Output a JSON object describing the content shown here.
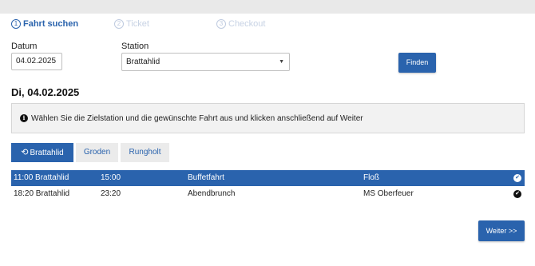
{
  "steps": [
    {
      "number": "1",
      "label": "Fahrt suchen"
    },
    {
      "number": "2",
      "label": "Ticket"
    },
    {
      "number": "3",
      "label": "Checkout"
    }
  ],
  "form": {
    "date_label": "Datum",
    "date_value": "04.02.2025",
    "station_label": "Station",
    "station_value": "Brattahlid",
    "find_button": "Finden"
  },
  "date_heading": "Di, 04.02.2025",
  "info_message": "Wählen Sie die Zielstation und die gewünschte Fahrt aus und klicken anschließend auf Weiter",
  "tabs": [
    {
      "label": "Brattahlid",
      "active": true
    },
    {
      "label": "Groden",
      "active": false
    },
    {
      "label": "Rungholt",
      "active": false
    }
  ],
  "trips": [
    {
      "departure": "11:00 Brattahlid",
      "arrival": "15:00",
      "name": "Buffetfahrt",
      "vessel": "Floß",
      "selected": true
    },
    {
      "departure": "18:20 Brattahlid",
      "arrival": "23:20",
      "name": "Abendbrunch",
      "vessel": "MS Oberfeuer",
      "selected": false
    }
  ],
  "next_button": "Weiter >>",
  "colors": {
    "accent": "#2a63ad",
    "info_bg": "#f2f2f2",
    "tab_inactive_bg": "#ebebeb"
  }
}
